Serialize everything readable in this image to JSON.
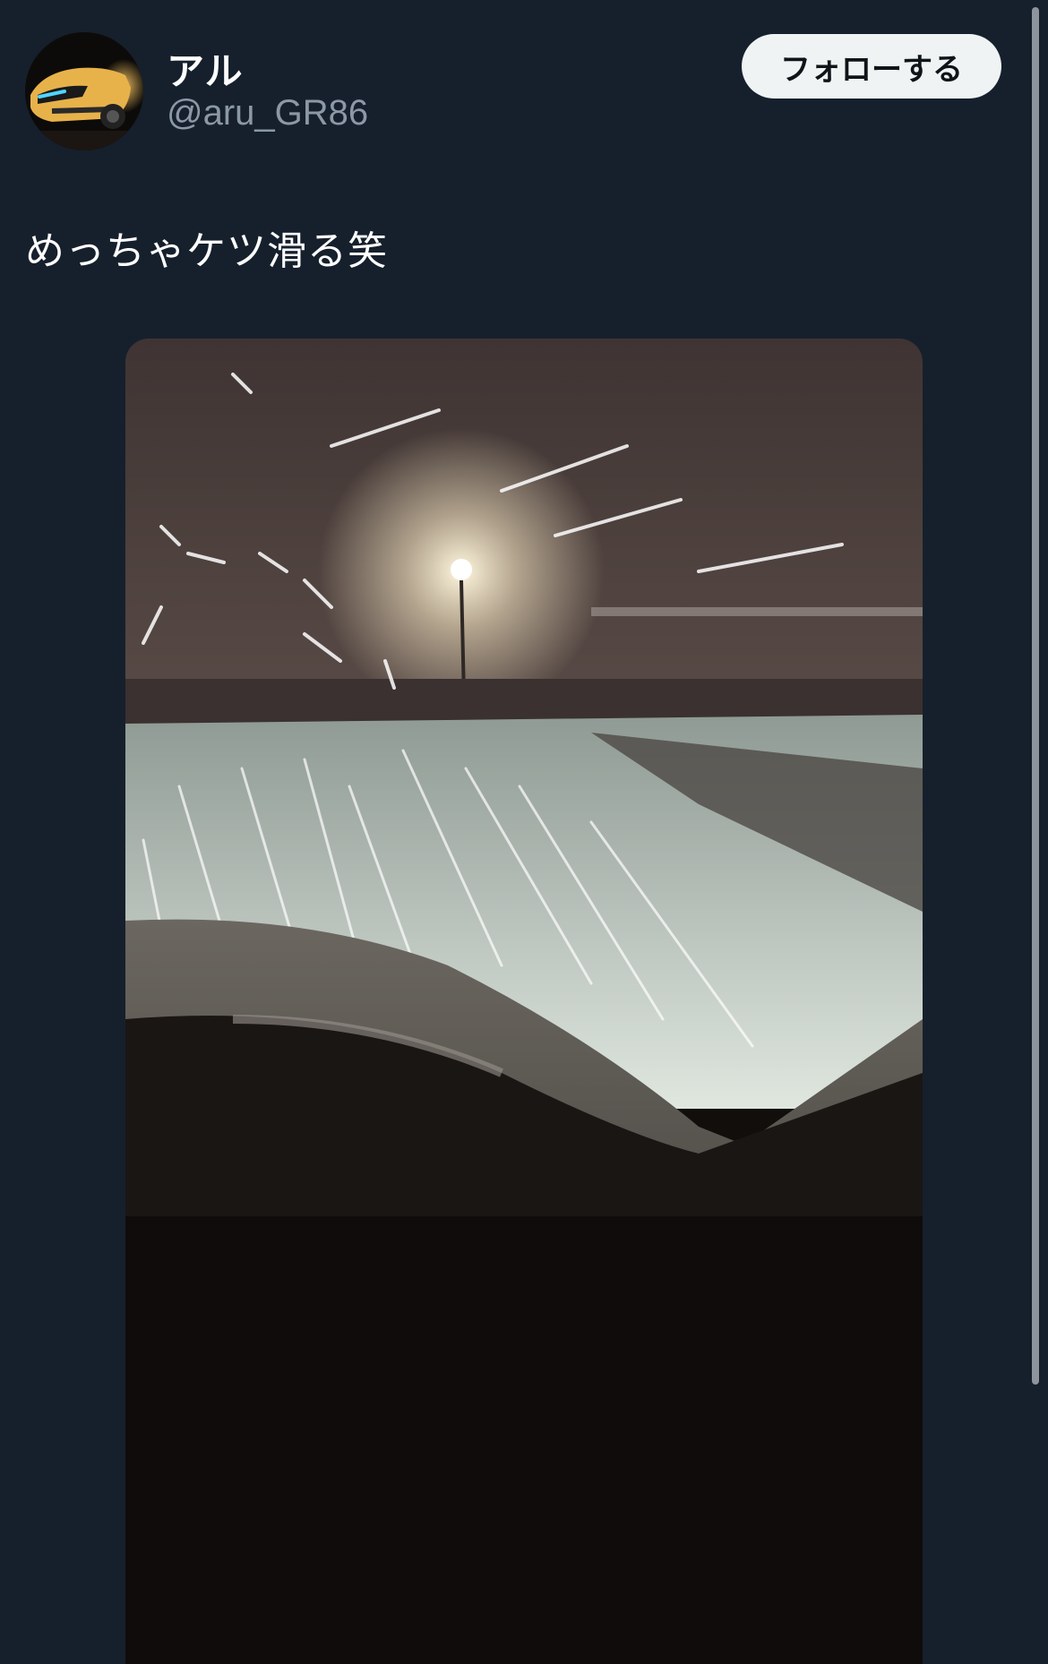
{
  "author": {
    "display_name": "アル",
    "handle": "@aru_GR86",
    "avatar_icon": "car-avatar"
  },
  "follow_button": {
    "label": "フォローする"
  },
  "tweet": {
    "text": "めっちゃケツ滑る笑"
  },
  "media": {
    "icon": "snowy-road-photo"
  },
  "colors": {
    "background": "#16202c",
    "text_primary": "#ffffff",
    "text_secondary": "#8b98a5",
    "button_bg": "#eff3f4"
  }
}
